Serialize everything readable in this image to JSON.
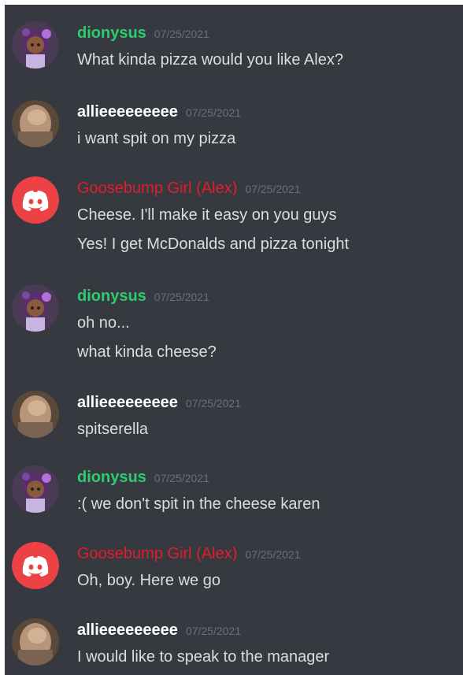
{
  "colors": {
    "background": "#36393f",
    "text": "#dcddde",
    "timestamp": "#6b6f76",
    "dionysus": "#2ecc71",
    "allie": "#ffffff",
    "alex": "#e01e2b",
    "discord_red_avatar": "#ed4245"
  },
  "messages": [
    {
      "author": "dionysus",
      "timestamp": "07/25/2021",
      "avatar": "anime-character-avatar",
      "lines": [
        "What kinda pizza would you like Alex?"
      ]
    },
    {
      "author": "allieeeeeeeee",
      "timestamp": "07/25/2021",
      "avatar": "photo-avatar",
      "lines": [
        "i want spit on my pizza"
      ]
    },
    {
      "author": "Goosebump Girl (Alex)",
      "timestamp": "07/25/2021",
      "avatar": "discord-default-avatar",
      "lines": [
        "Cheese. I'll make it easy on you guys",
        "Yes! I get McDonalds and pizza tonight"
      ]
    },
    {
      "author": "dionysus",
      "timestamp": "07/25/2021",
      "avatar": "anime-character-avatar",
      "lines": [
        "oh no...",
        "what kinda cheese?"
      ]
    },
    {
      "author": "allieeeeeeeee",
      "timestamp": "07/25/2021",
      "avatar": "photo-avatar",
      "lines": [
        "spitserella"
      ]
    },
    {
      "author": "dionysus",
      "timestamp": "07/25/2021",
      "avatar": "anime-character-avatar",
      "lines": [
        ":( we don't spit in the cheese karen"
      ]
    },
    {
      "author": "Goosebump Girl (Alex)",
      "timestamp": "07/25/2021",
      "avatar": "discord-default-avatar",
      "lines": [
        "Oh, boy. Here we go"
      ]
    },
    {
      "author": "allieeeeeeeee",
      "timestamp": "07/25/2021",
      "avatar": "photo-avatar",
      "lines": [
        "I would like to speak to the manager"
      ]
    }
  ]
}
